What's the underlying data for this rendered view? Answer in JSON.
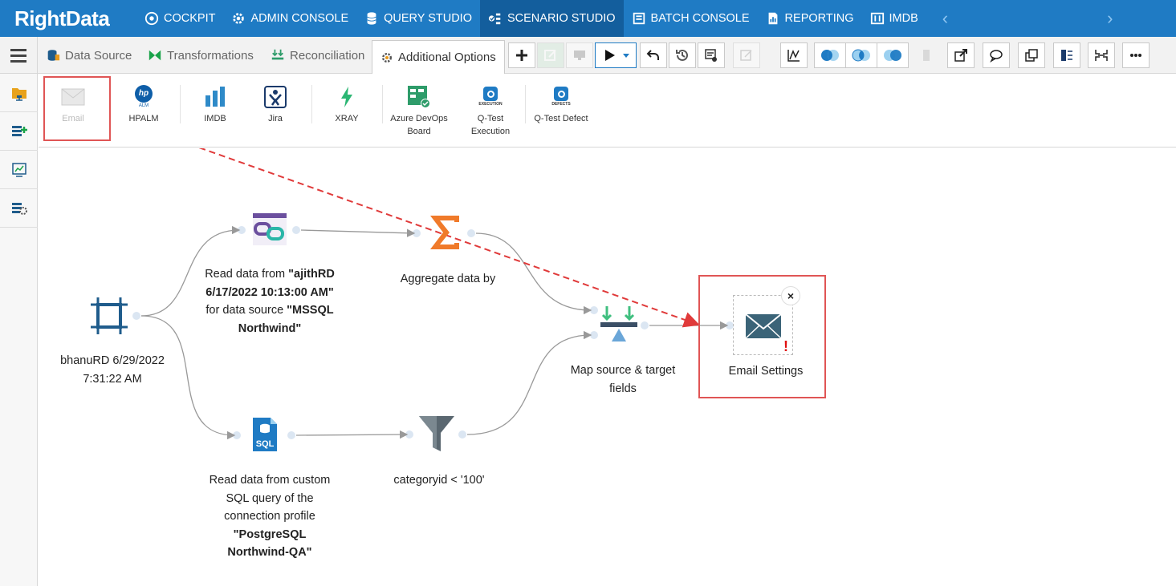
{
  "brand": "RightData",
  "nav": {
    "items": [
      {
        "label": "COCKPIT"
      },
      {
        "label": "ADMIN CONSOLE"
      },
      {
        "label": "QUERY STUDIO"
      },
      {
        "label": "SCENARIO STUDIO"
      },
      {
        "label": "BATCH CONSOLE"
      },
      {
        "label": "REPORTING"
      },
      {
        "label": "IMDB"
      }
    ],
    "active": "SCENARIO STUDIO"
  },
  "tabs": {
    "items": [
      {
        "label": "Data Source"
      },
      {
        "label": "Transformations"
      },
      {
        "label": "Reconciliation"
      },
      {
        "label": "Additional Options"
      }
    ],
    "active": "Additional Options"
  },
  "options": {
    "items": [
      {
        "label": "Email"
      },
      {
        "label": "HPALM"
      },
      {
        "label": "IMDB"
      },
      {
        "label": "Jira"
      },
      {
        "label": "XRAY"
      },
      {
        "label": "Azure DevOps Board"
      },
      {
        "label": "Q-Test Execution"
      },
      {
        "label": "Q-Test Defect"
      }
    ],
    "hp_icon_text": "ALM",
    "qtest_exec_icon_text": "EXECUTION",
    "qtest_defect_icon_text": "DEFECTS"
  },
  "nodes": {
    "start": {
      "line1": "bhanuRD 6/29/2022",
      "line2": "7:31:22 AM"
    },
    "read1": {
      "pre": "Read data from ",
      "b1": "\"ajithRD",
      "b2": "6/17/2022 10:13:00 AM\"",
      "mid": "for data source ",
      "b3": "\"MSSQL",
      "b4": "Northwind\""
    },
    "aggregate": {
      "label": "Aggregate data by"
    },
    "map": {
      "line1": "Map source & target",
      "line2": "fields"
    },
    "email": {
      "label": "Email Settings",
      "close": "×",
      "warn": "!"
    },
    "read2": {
      "line1": "Read data from custom",
      "line2": "SQL query of the",
      "line3": "connection profile",
      "b1": "\"PostgreSQL",
      "b2": "Northwind-QA\"",
      "icon_text": "SQL"
    },
    "filter": {
      "label": "categoryid < '100'"
    }
  },
  "colors": {
    "nav_bg": "#1f7bc4",
    "nav_active": "#135e9d",
    "annotation_red": "#e05555",
    "aggregate_orange": "#f07a2a"
  }
}
